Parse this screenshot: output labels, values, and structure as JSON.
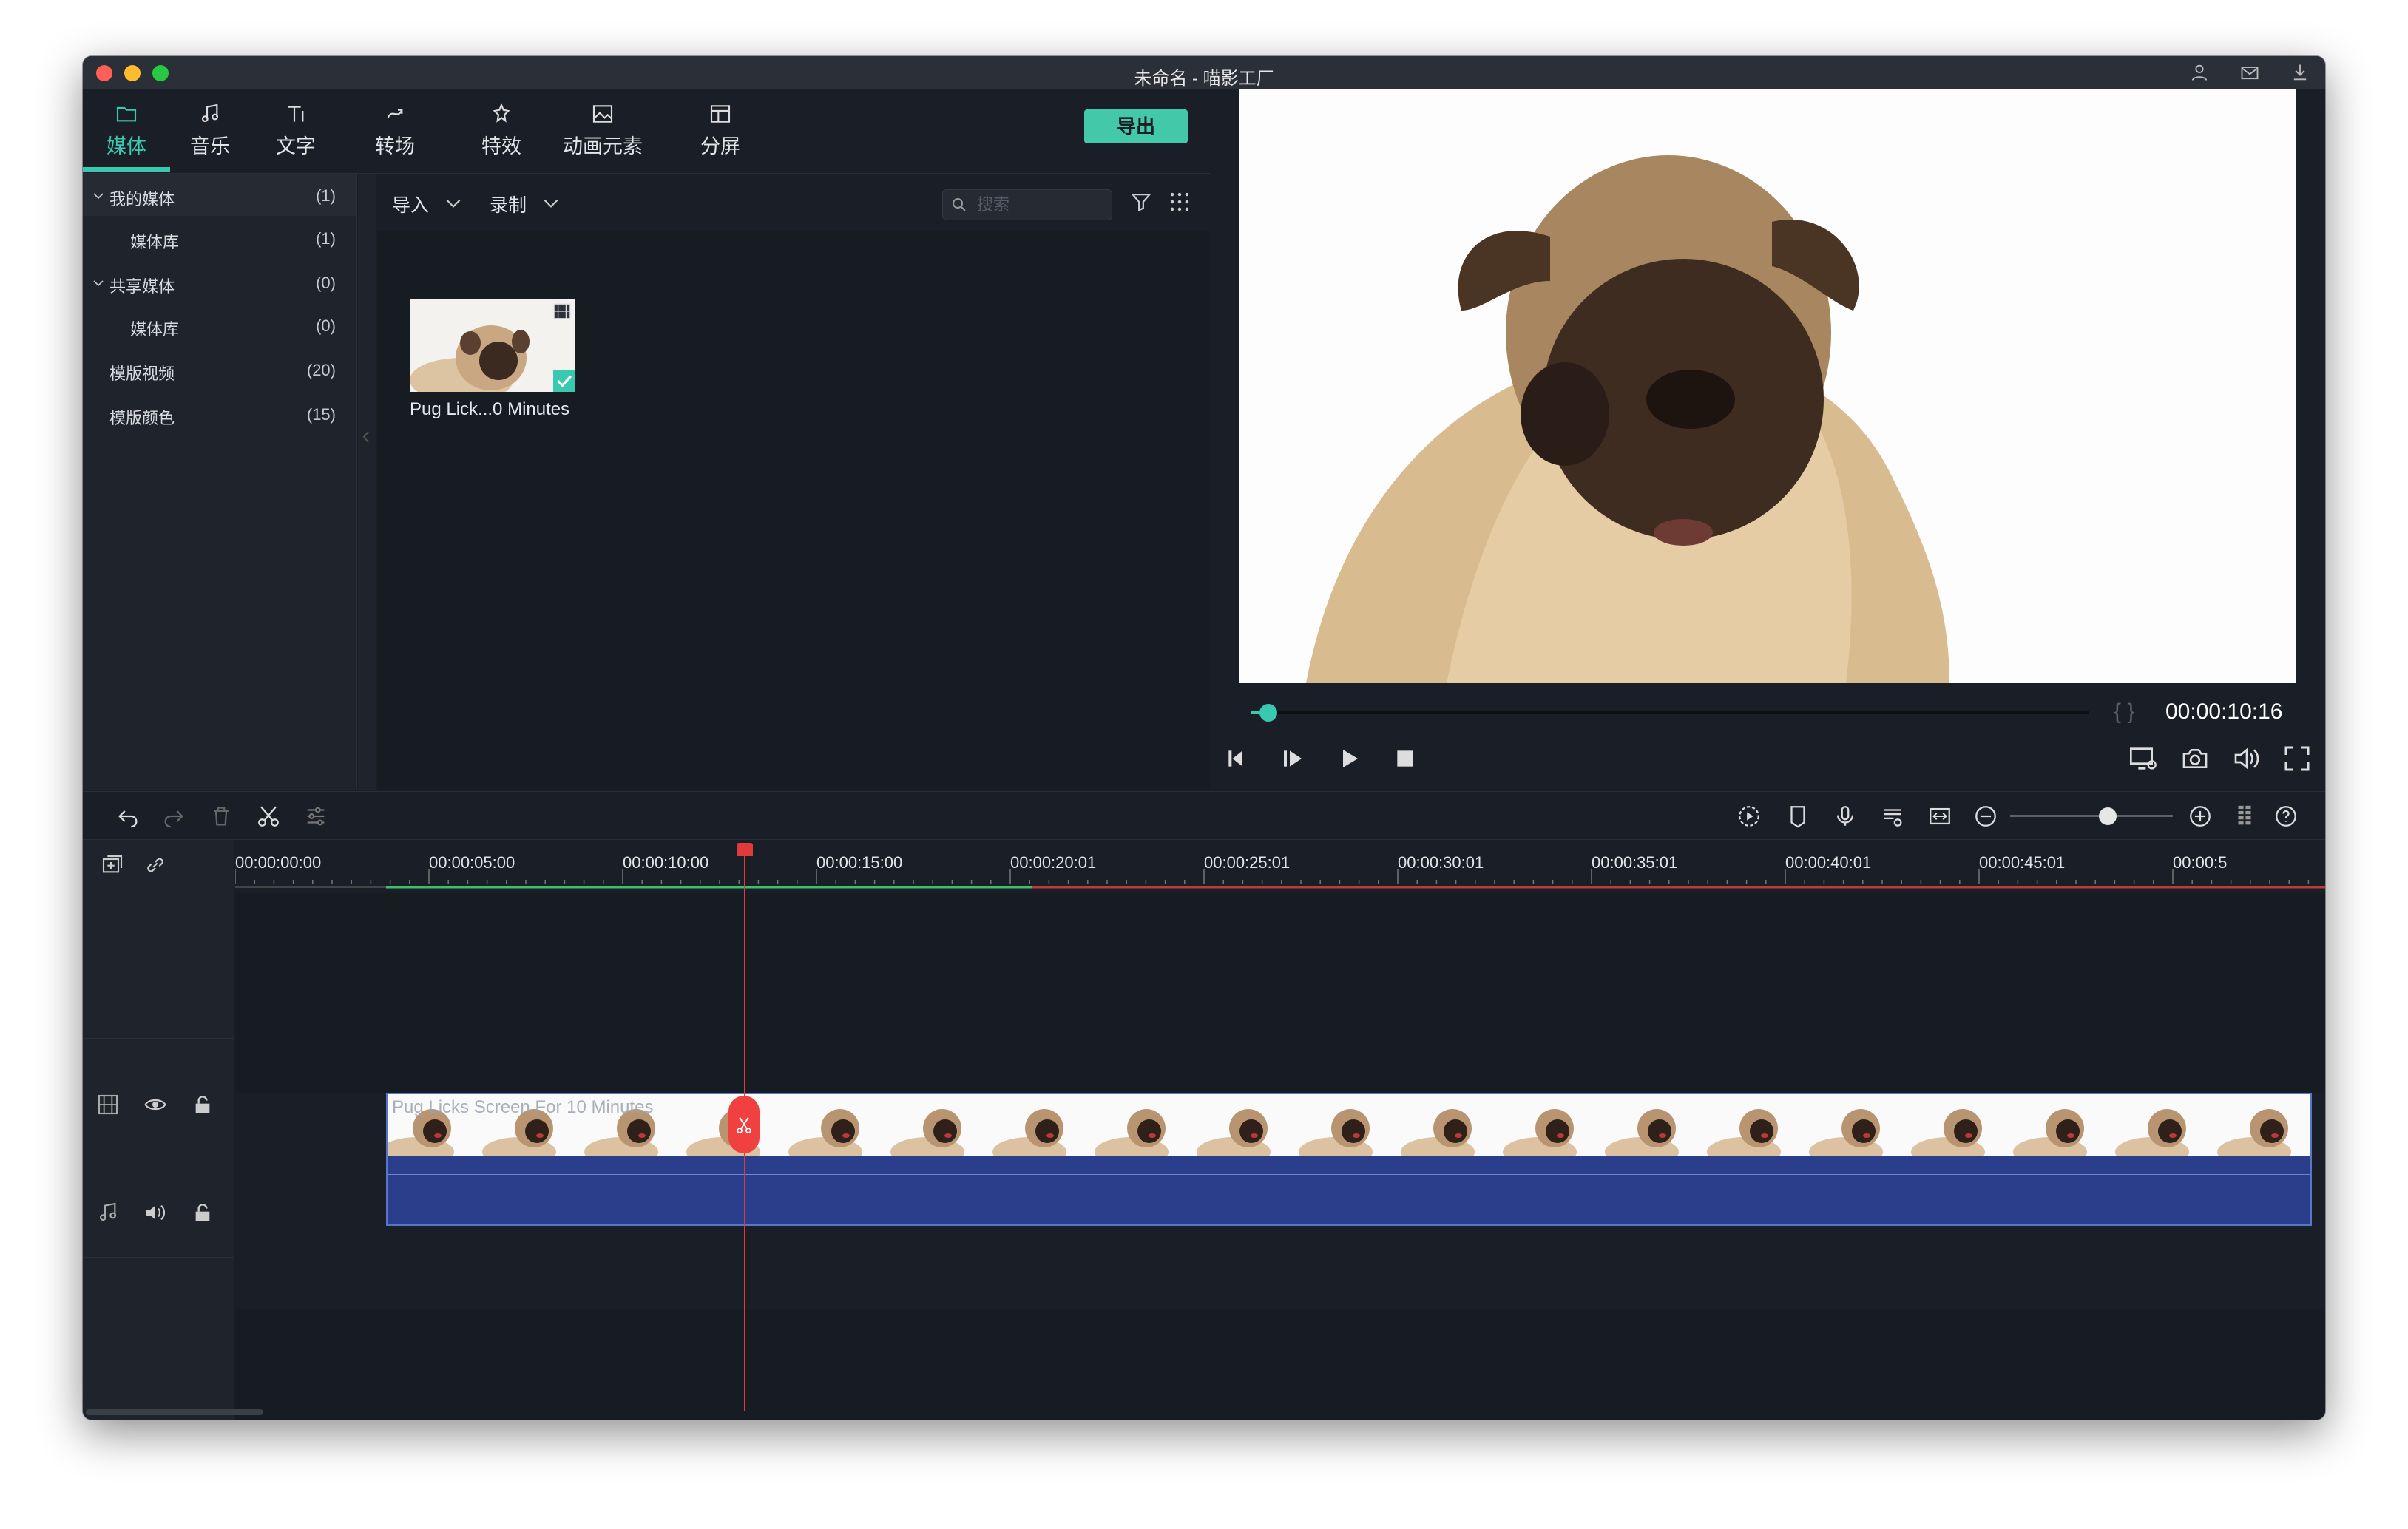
{
  "window": {
    "title": "未命名 - 喵影工厂"
  },
  "tabs": [
    {
      "label": "媒体",
      "icon": "folder-icon",
      "active": true
    },
    {
      "label": "音乐",
      "icon": "music-note-icon"
    },
    {
      "label": "文字",
      "icon": "text-icon"
    },
    {
      "label": "转场",
      "icon": "transition-icon"
    },
    {
      "label": "特效",
      "icon": "effects-icon"
    },
    {
      "label": "动画元素",
      "icon": "image-icon"
    },
    {
      "label": "分屏",
      "icon": "split-screen-icon"
    }
  ],
  "export_label": "导出",
  "sidebar": {
    "items": [
      {
        "label": "我的媒体",
        "count": "(1)",
        "expanded": true
      },
      {
        "label": "媒体库",
        "count": "(1)"
      },
      {
        "label": "共享媒体",
        "count": "(0)",
        "expanded": true
      },
      {
        "label": "媒体库",
        "count": "(0)"
      },
      {
        "label": "模版视频",
        "count": "(20)"
      },
      {
        "label": "模版颜色",
        "count": "(15)"
      }
    ]
  },
  "media_toolbar": {
    "import_label": "导入",
    "record_label": "录制",
    "search_placeholder": "搜索"
  },
  "media_items": [
    {
      "label": "Pug Lick...0 Minutes",
      "selected": true
    }
  ],
  "preview": {
    "timecode": "00:00:10:16",
    "braces": "{ }",
    "progress": 0.02
  },
  "timeline": {
    "ruler_labels": [
      "00:00:00:00",
      "00:00:05:00",
      "00:00:10:00",
      "00:00:15:00",
      "00:00:20:01",
      "00:00:25:01",
      "00:00:30:01",
      "00:00:35:01",
      "00:00:40:01",
      "00:00:45:01",
      "00:00:5"
    ],
    "clip_title": "Pug Licks Screen For 10 Minutes",
    "zoom_level": 0.6
  },
  "colors": {
    "accent": "#39c9b0",
    "playhead": "#e23a3a",
    "clip": "#2a3e8c"
  }
}
